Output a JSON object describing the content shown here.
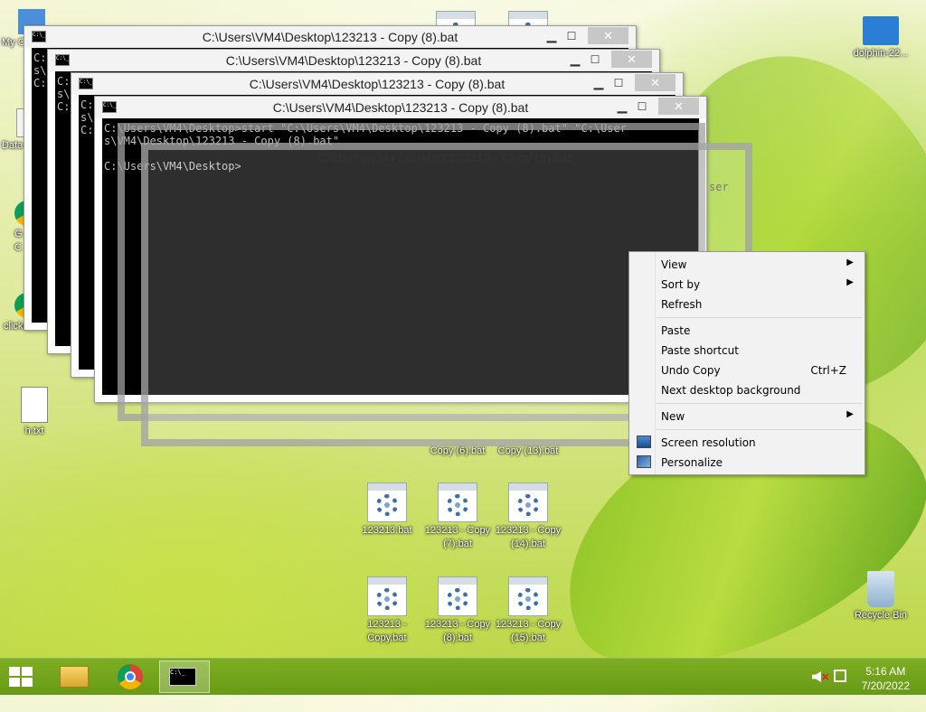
{
  "desktop": {
    "left_icons": [
      {
        "label": "My C",
        "kind": "computer"
      },
      {
        "label": "Data",
        "kind": "shortcut"
      },
      {
        "label": "G\nC",
        "kind": "chrome"
      },
      {
        "label": "clickme",
        "kind": "chrome"
      },
      {
        "label": "h.txt",
        "kind": "text"
      }
    ],
    "right_icons": [
      {
        "label": "dolphin-22...",
        "kind": "folder"
      },
      {
        "label": "Recycle Bin",
        "kind": "recycle-bin"
      }
    ],
    "bat_icons": [
      {
        "label": "123213.bat"
      },
      {
        "label": "123213 - Copy (7).bat"
      },
      {
        "label": "123213 - Copy (14).bat"
      },
      {
        "label": "123213 - Copy.bat"
      },
      {
        "label": "123213 - Copy (8).bat"
      },
      {
        "label": "123213 - Copy (15).bat"
      }
    ],
    "partial_labels": [
      "Copy (6).bat",
      "Copy (13).bat"
    ]
  },
  "cmd_windows": {
    "title": "C:\\Users\\VM4\\Desktop\\123213 - Copy (8).bat",
    "minimize_glyph": "▁",
    "maximize_glyph": "☐",
    "close_glyph": "✕",
    "icon_text": "C:\\_",
    "stack_lines": [
      "C:\ns\\\nC:",
      "C:\ns\\\nC:",
      "C:\ns\\\nC:"
    ],
    "front_terminal": "C:\\Users\\VM4\\Desktop>start \"C:\\Users\\VM4\\Desktop\\123213 - Copy (8).bat\" \"C:\\User\ns\\VM4\\Desktop\\123213 - Copy (8).bat\"\n\nC:\\Users\\VM4\\Desktop>",
    "ghost_overlay_text": "ser"
  },
  "context_menu": {
    "items": [
      {
        "label": "View",
        "submenu": true
      },
      {
        "label": "Sort by",
        "submenu": true
      },
      {
        "label": "Refresh"
      },
      {
        "label": "Paste"
      },
      {
        "label": "Paste shortcut"
      },
      {
        "label": "Undo Copy",
        "shortcut": "Ctrl+Z"
      },
      {
        "label": "Next desktop background"
      },
      {
        "label": "New",
        "submenu": true
      },
      {
        "label": "Screen resolution",
        "icon": "screen-resolution-icon"
      },
      {
        "label": "Personalize",
        "icon": "personalize-icon"
      }
    ],
    "submenu_arrow": "▶"
  },
  "taskbar": {
    "pinned": [
      "file-explorer-icon",
      "chrome-icon",
      "command-prompt-icon"
    ],
    "cmd_icon_text": "C:\\_",
    "tray": {
      "volume": "muted",
      "network": "network-icon"
    },
    "time": "5:16 AM",
    "date": "7/20/2022"
  }
}
